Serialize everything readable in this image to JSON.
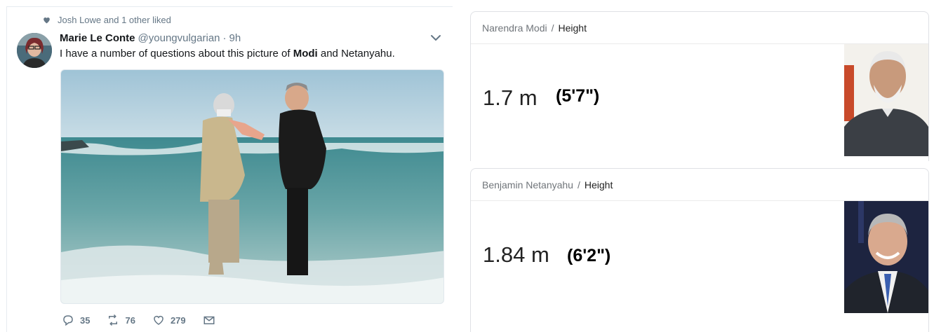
{
  "tweet": {
    "liked_by": "Josh Lowe and 1 other liked",
    "author_name": "Marie Le Conte",
    "handle": "@youngvulgarian",
    "separator": "·",
    "time": "9h",
    "text_before": "I have a number of questions about this picture of ",
    "text_bold": "Modi",
    "text_after": " and Netanyahu.",
    "replies": "35",
    "retweets": "76",
    "likes": "279"
  },
  "cards": [
    {
      "person": "Narendra Modi",
      "separator": "/",
      "attribute": "Height",
      "value_metric": "1.7 m",
      "value_imperial": "(5'7\")"
    },
    {
      "person": "Benjamin Netanyahu",
      "separator": "/",
      "attribute": "Height",
      "value_metric": "1.84 m",
      "value_imperial": "(6'2\")"
    }
  ],
  "colors": {
    "twitter_gray": "#657786",
    "text": "#14171a",
    "card_border": "#dfe1e5"
  }
}
